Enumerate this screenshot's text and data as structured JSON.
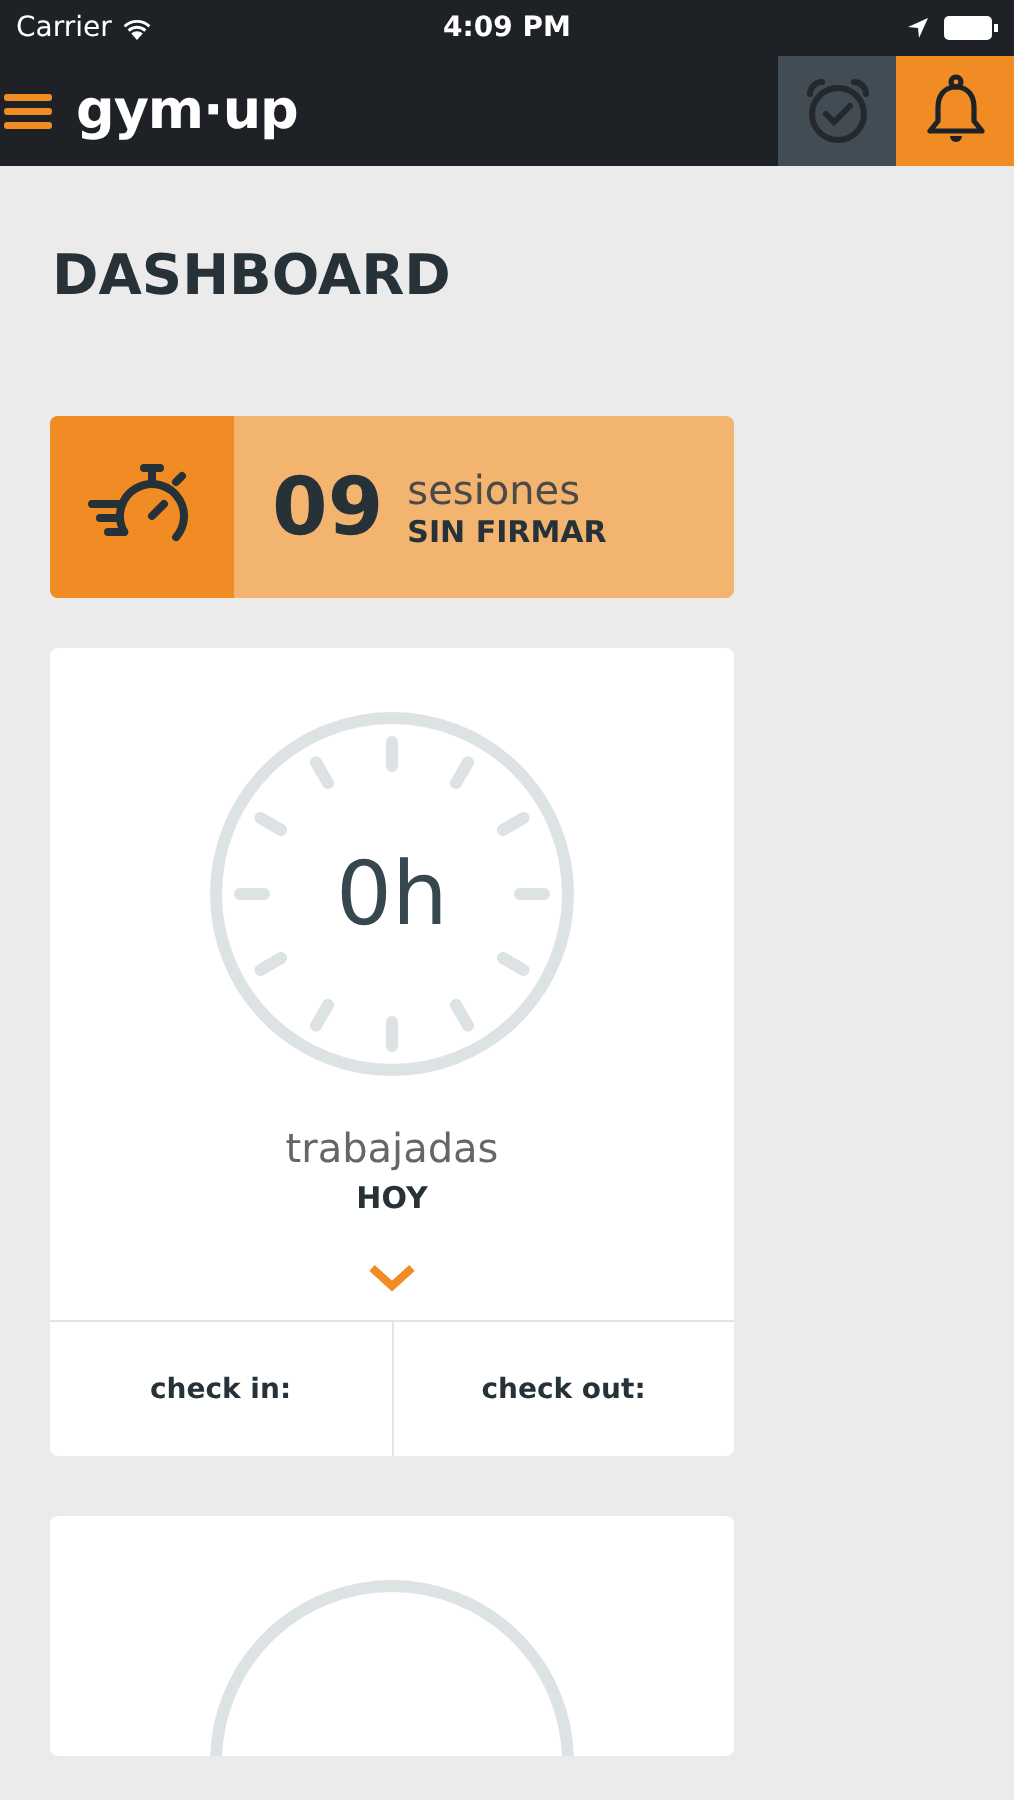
{
  "status_bar": {
    "carrier": "Carrier",
    "time": "4:09 PM"
  },
  "nav": {
    "logo": "gym·up",
    "alarm_selected": false,
    "bell_selected": true
  },
  "title": "DASHBOARD",
  "sessions": {
    "count": "09",
    "label": "sesiones",
    "sublabel": "SIN FIRMAR"
  },
  "cards": [
    {
      "kind": "full",
      "hours": "0h",
      "label": "trabajadas",
      "sublabel": "HOY",
      "check_in": "check in:",
      "check_out": "check out:"
    },
    {
      "kind": "cut"
    }
  ]
}
